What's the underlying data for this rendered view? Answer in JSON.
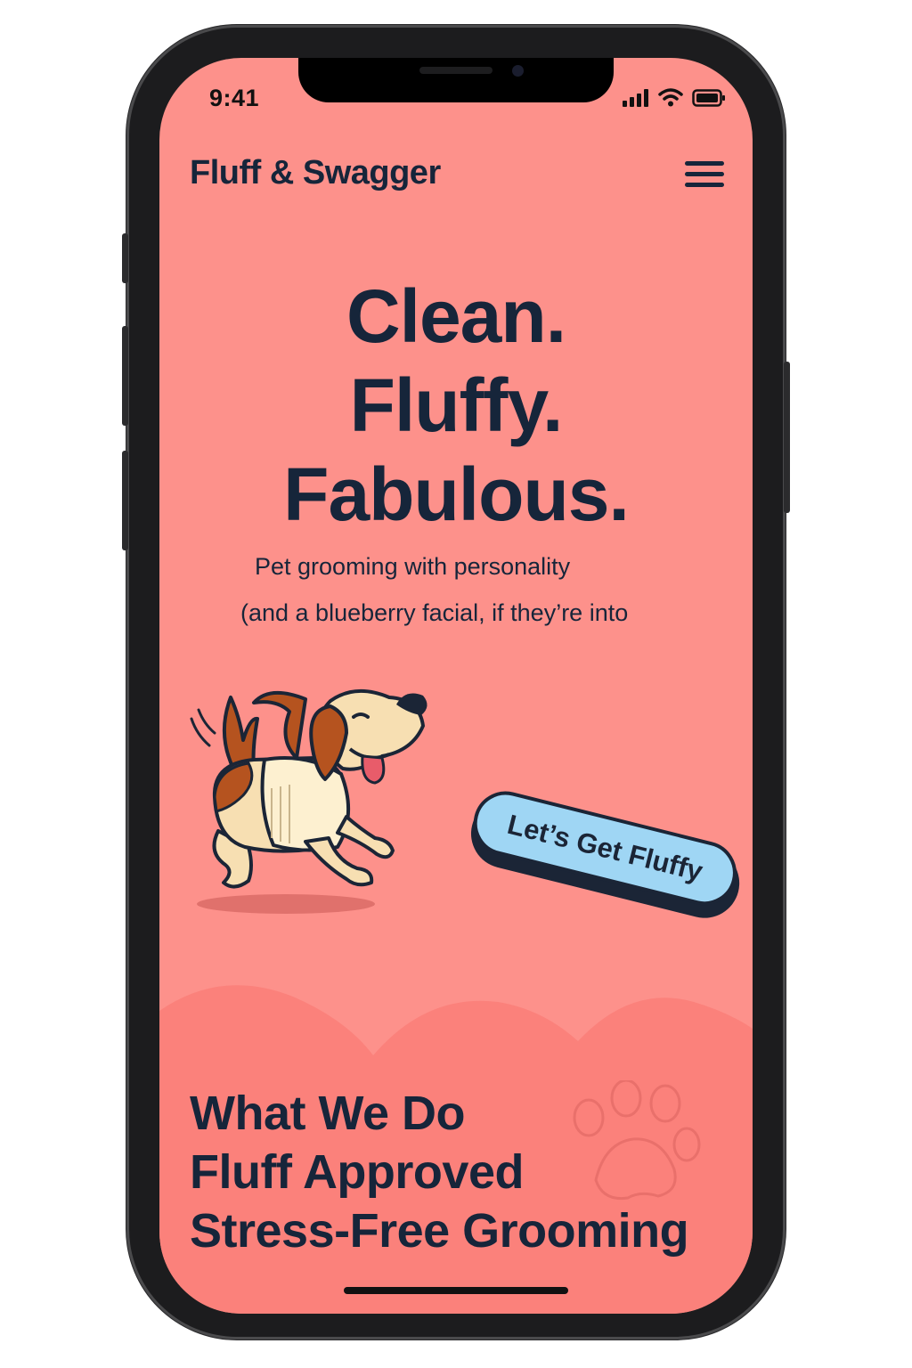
{
  "status_bar": {
    "time": "9:41",
    "icons": [
      "signal-icon",
      "wifi-icon",
      "battery-icon"
    ]
  },
  "header": {
    "brand": "Fluff & Swagger",
    "menu_icon": "hamburger-menu-icon"
  },
  "hero": {
    "title_lines": [
      "Clean.",
      "Fluffy.",
      "Fabulous."
    ],
    "subtitle_line1": "Pet grooming with personality",
    "subtitle_line2": "(and a blueberry facial, if they’re into",
    "illustration": "running-dog-illustration",
    "cta_label": "Let’s Get Fluffy"
  },
  "services": {
    "lines": [
      "What We Do",
      "Fluff Approved",
      "Stress-Free Grooming"
    ],
    "decoration": "paw-print-icon"
  },
  "colors": {
    "background": "#fd918b",
    "wave": "#fb817b",
    "text": "#16253a",
    "cta": "#9fd6f4"
  }
}
